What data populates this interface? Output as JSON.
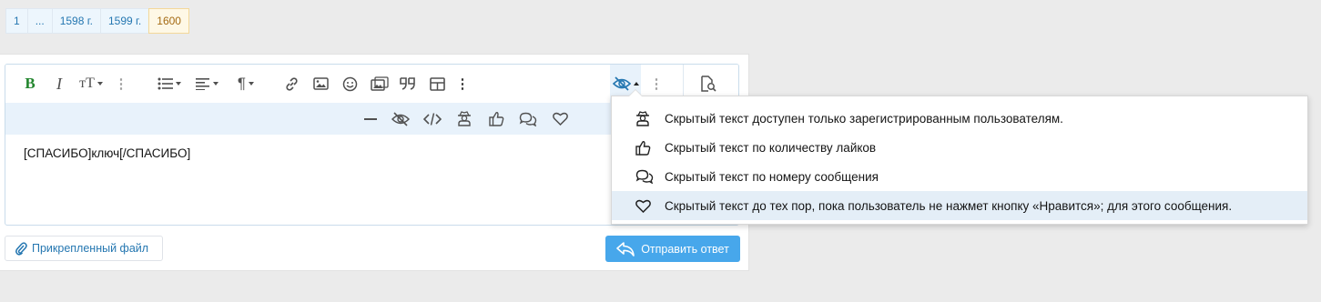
{
  "pagination": {
    "pages": [
      "1",
      "...",
      "1598 г.",
      "1599 г.",
      "1600"
    ],
    "current": "1600"
  },
  "toolbar": {
    "primary": [
      {
        "name": "bold-button",
        "label": "B"
      },
      {
        "name": "italic-button",
        "label": "I"
      },
      {
        "name": "text-size-button",
        "label": "тТ"
      },
      {
        "name": "more-text-options",
        "icon": "kebab-icon"
      },
      {
        "name": "list-button",
        "icon": "list-icon"
      },
      {
        "name": "align-button",
        "icon": "align-left-icon"
      },
      {
        "name": "paragraph-button",
        "icon": "paragraph-icon"
      },
      {
        "name": "link-button",
        "icon": "link-icon"
      },
      {
        "name": "image-button",
        "icon": "image-icon"
      },
      {
        "name": "smilie-button",
        "icon": "smile-icon"
      },
      {
        "name": "media-button",
        "icon": "media-icon"
      },
      {
        "name": "quote-button",
        "icon": "quote-icon"
      },
      {
        "name": "table-button",
        "icon": "table-icon"
      },
      {
        "name": "more-insert-options",
        "icon": "kebab-icon"
      },
      {
        "name": "hide-button",
        "icon": "eye-slash-icon"
      },
      {
        "name": "more-options",
        "icon": "kebab-icon"
      },
      {
        "name": "preview-button",
        "icon": "preview-icon"
      }
    ],
    "secondary": [
      {
        "name": "horizontal-rule-button",
        "icon": "minus-icon"
      },
      {
        "name": "hide-text-button",
        "icon": "eye-slash-icon"
      },
      {
        "name": "code-button",
        "icon": "code-icon"
      },
      {
        "name": "hide-registered-button",
        "icon": "user-secret-icon"
      },
      {
        "name": "hide-likes-button",
        "icon": "thumbs-up-icon"
      },
      {
        "name": "hide-posts-button",
        "icon": "comments-icon"
      },
      {
        "name": "hide-thanks-button",
        "icon": "heart-icon"
      }
    ]
  },
  "editor": {
    "content": "[СПАСИБО]ключ[/СПАСИБО]"
  },
  "actions": {
    "attach_label": "Прикрепленный файл",
    "send_label": "Отправить ответ"
  },
  "hide_menu": {
    "items": [
      {
        "icon": "user-secret-icon",
        "label": "Скрытый текст доступен только зарегистрированным пользователям."
      },
      {
        "icon": "thumbs-up-icon",
        "label": "Скрытый текст по количеству лайков"
      },
      {
        "icon": "comments-icon",
        "label": "Скрытый текст по номеру сообщения"
      },
      {
        "icon": "heart-icon",
        "label": "Скрытый текст до тех пор, пока пользователь не нажмет кнопку «Нравится»; для этого сообщения."
      }
    ],
    "highlighted_index": 3
  },
  "colors": {
    "accent": "#47a7eb",
    "bold_green": "#23862e",
    "link": "#2577b1",
    "toolbar_secondary_bg": "#e8f2fb",
    "page_bg": "#ebebeb"
  }
}
